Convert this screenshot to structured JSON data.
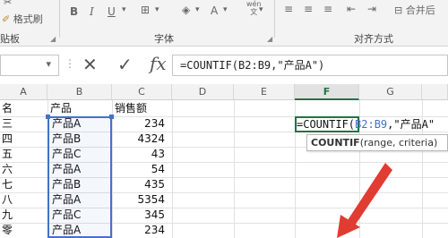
{
  "ribbon": {
    "format_painter": "格式刷",
    "clipboard_group": "贴板",
    "font_group": "字体",
    "align_group": "对齐方式",
    "bold": "B",
    "italic": "I",
    "underline": "U",
    "font_color": "A",
    "wen": "wén\n文",
    "merge_center": "合并后"
  },
  "formula_bar": {
    "name_box": "",
    "fx": "fx",
    "cancel_glyph": "✕",
    "confirm_glyph": "✓",
    "content": "=COUNTIF(B2:B9,\"产品A\")"
  },
  "sheet": {
    "row_headers_hidden": true,
    "columns": [
      "A",
      "B",
      "C",
      "D",
      "E",
      "F",
      "G"
    ],
    "active_column": "F",
    "header_row": {
      "a": "名",
      "b": "产品",
      "c": "销售额"
    },
    "rows": [
      {
        "a": "三",
        "b": "产品A",
        "c": "234"
      },
      {
        "a": "四",
        "b": "产品B",
        "c": "4324"
      },
      {
        "a": "五",
        "b": "产品C",
        "c": "43"
      },
      {
        "a": "六",
        "b": "产品A",
        "c": "54"
      },
      {
        "a": "七",
        "b": "产品B",
        "c": "435"
      },
      {
        "a": "八",
        "b": "产品A",
        "c": "5354"
      },
      {
        "a": "九",
        "b": "产品C",
        "c": "345"
      },
      {
        "a": "零",
        "b": "产品A",
        "c": "234"
      }
    ],
    "edit_cell": {
      "prefix": "=COUNTIF(",
      "ref": "B2:B9",
      "suffix": ",\"产品A\""
    },
    "tooltip": {
      "fn": "COUNTIF",
      "args": "(range, criteria)"
    }
  },
  "colors": {
    "accent_green": "#217346",
    "ref_blue": "#4472c4",
    "arrow_red": "#e03c31"
  }
}
